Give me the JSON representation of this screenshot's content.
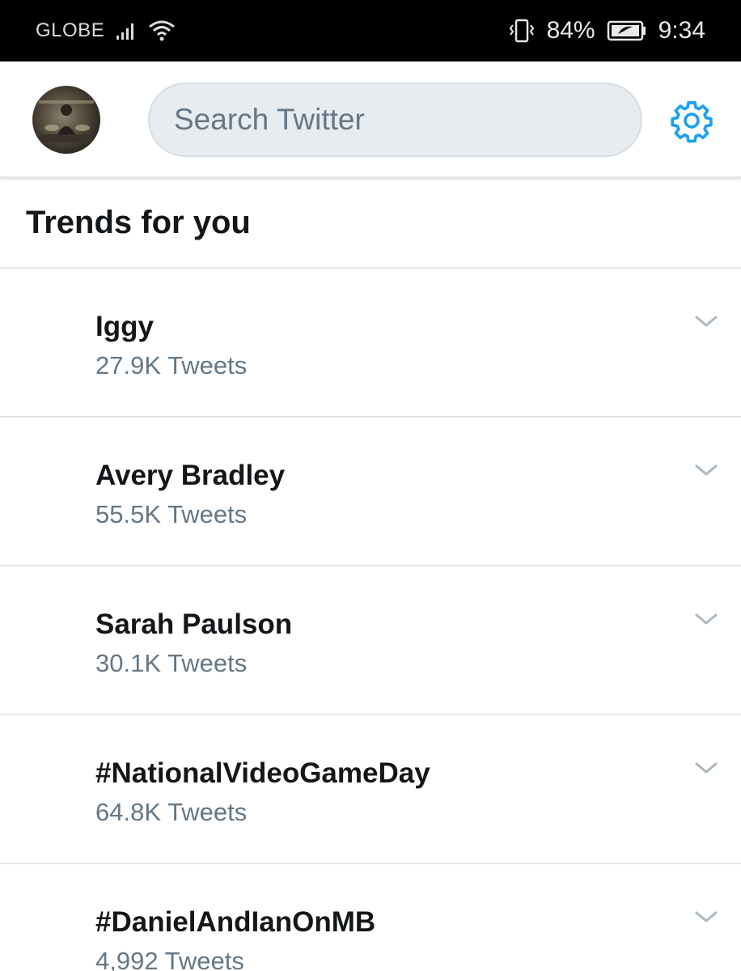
{
  "status_bar": {
    "carrier": "GLOBE",
    "battery": "84%",
    "time": "9:34",
    "icons": [
      "signal-icon",
      "wifi-icon",
      "vibrate-icon",
      "battery-icon"
    ]
  },
  "header": {
    "search_placeholder": "Search Twitter",
    "icons": [
      "avatar",
      "settings-gear-icon"
    ]
  },
  "section": {
    "title": "Trends for you"
  },
  "trends": [
    {
      "name": "Iggy",
      "count": "27.9K Tweets"
    },
    {
      "name": "Avery Bradley",
      "count": "55.5K Tweets"
    },
    {
      "name": "Sarah Paulson",
      "count": "30.1K Tweets"
    },
    {
      "name": "#NationalVideoGameDay",
      "count": "64.8K Tweets"
    },
    {
      "name": "#DanielAndIanOnMB",
      "count": "4,992 Tweets"
    }
  ],
  "colors": {
    "accent": "#1da1f2",
    "text_primary": "#14171a",
    "text_secondary": "#657786",
    "divider": "#e1e8ed"
  }
}
